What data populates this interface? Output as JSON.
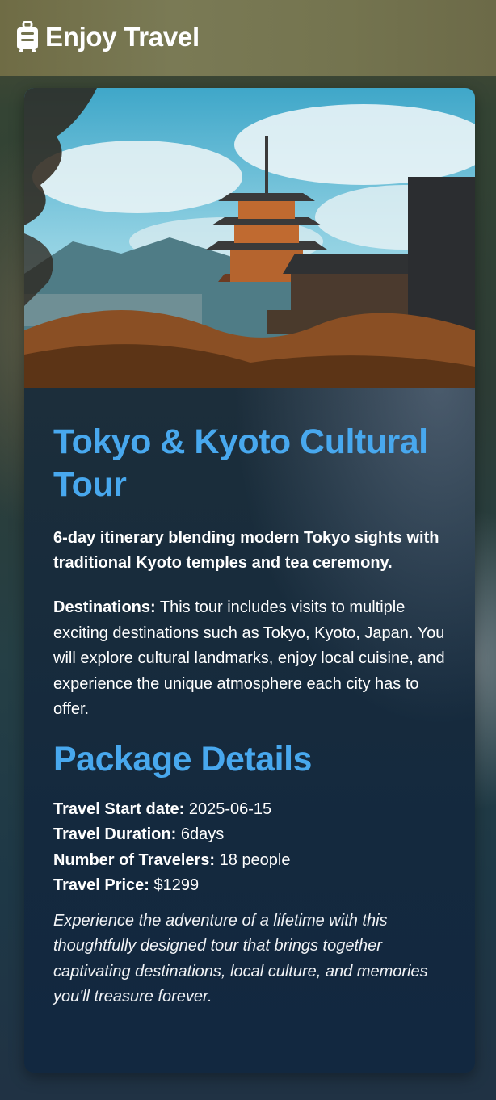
{
  "header": {
    "brand_icon": "luggage-icon",
    "brand_title": "Enjoy Travel"
  },
  "tour": {
    "hero_image": "kyoto-pagoda-temple-photo",
    "title": "Tokyo & Kyoto Cultural Tour",
    "summary": "6-day itinerary blending modern Tokyo sights with traditional Kyoto temples and tea ceremony.",
    "destinations_label": "Destinations:",
    "destinations_text": " This tour includes visits to multiple exciting destinations such as Tokyo, Kyoto, Japan. You will explore cultural landmarks, enjoy local cuisine, and experience the unique atmosphere each city has to offer."
  },
  "package": {
    "heading": "Package Details",
    "details": [
      {
        "label": "Travel Start date:",
        "value": " 2025-06-15"
      },
      {
        "label": "Travel Duration:",
        "value": " 6days"
      },
      {
        "label": "Number of Travelers:",
        "value": " 18 people"
      },
      {
        "label": "Travel Price:",
        "value": " $1299"
      }
    ],
    "closing": "Experience the adventure of a lifetime with this thoughtfully designed tour that brings together captivating destinations, local culture, and memories you'll treasure forever."
  },
  "colors": {
    "accent": "#48a8ee",
    "card_bg": "#14293e",
    "header_bg": "#74744f"
  }
}
